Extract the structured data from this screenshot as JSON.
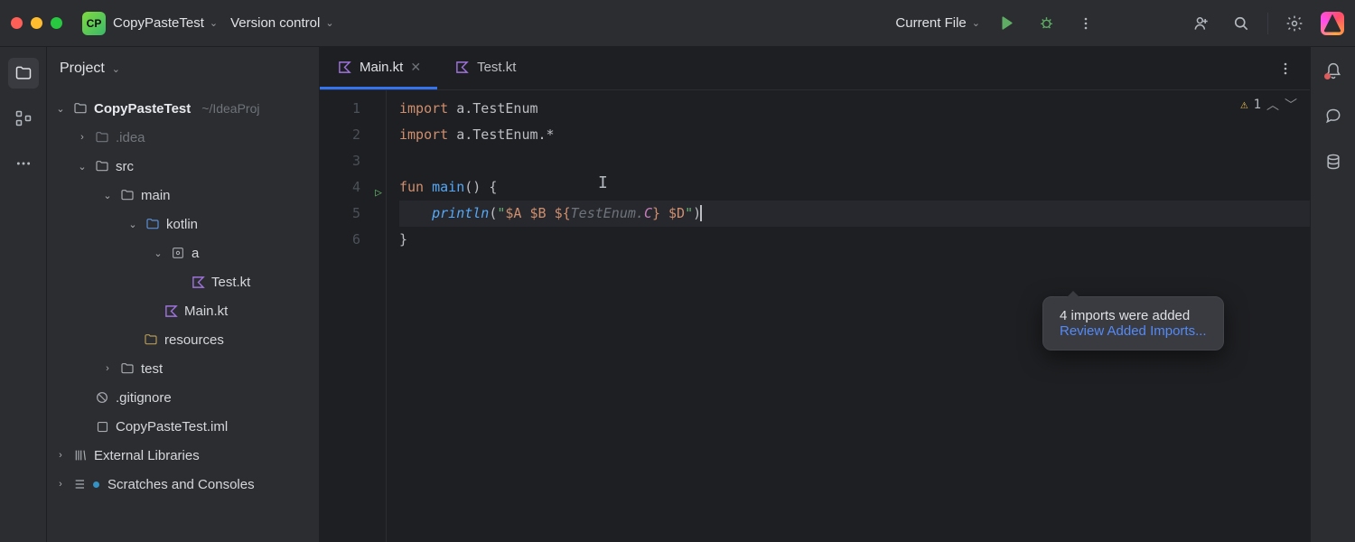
{
  "titlebar": {
    "project": "CopyPasteTest",
    "vcs": "Version control",
    "run_config": "Current File"
  },
  "project_panel": {
    "title": "Project"
  },
  "tree": {
    "root": {
      "label": "CopyPasteTest",
      "path": "~/IdeaProj"
    },
    "idea": ".idea",
    "src": "src",
    "main": "main",
    "kotlin": "kotlin",
    "pkg_a": "a",
    "test_kt": "Test.kt",
    "main_kt": "Main.kt",
    "resources": "resources",
    "test_dir": "test",
    "gitignore": ".gitignore",
    "iml": "CopyPasteTest.iml",
    "ext_libs": "External Libraries",
    "scratches": "Scratches and Consoles"
  },
  "tabs": {
    "main": "Main.kt",
    "test": "Test.kt"
  },
  "gutter": {
    "l1": "1",
    "l2": "2",
    "l3": "3",
    "l4": "4",
    "l5": "5",
    "l6": "6"
  },
  "code": {
    "l1": {
      "kw": "import",
      "rest": " a.TestEnum"
    },
    "l2": {
      "kw": "import",
      "rest": " a.TestEnum.*"
    },
    "l4": {
      "kw": "fun ",
      "fn": "main",
      "rest": "() {"
    },
    "l5": {
      "indent": "    ",
      "fn": "println",
      "p1": "(",
      "s1": "\"",
      "t1": "$A",
      "s2": " ",
      "t2": "$B",
      "s3": " ",
      "t3o": "${",
      "hint": "TestEnum.",
      "rf": "C",
      "t3c": "}",
      "s4": " ",
      "t4": "$D",
      "s5": "\"",
      "p2": ")"
    },
    "l6": "}"
  },
  "inspection": {
    "warn_count": "1"
  },
  "popup": {
    "msg": "4 imports were added",
    "link": "Review Added Imports..."
  }
}
